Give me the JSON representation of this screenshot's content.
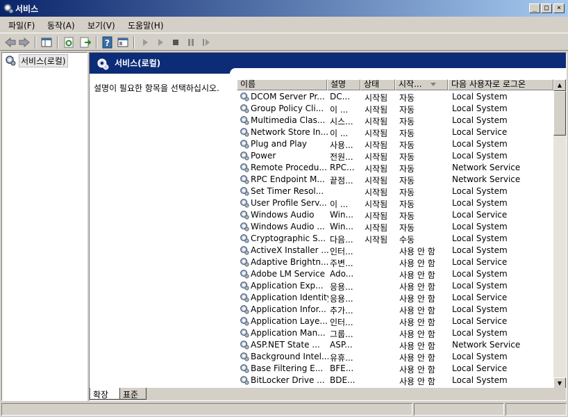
{
  "window": {
    "title": "서비스",
    "controls": [
      "_",
      "□",
      "×"
    ]
  },
  "menu": [
    "파일(F)",
    "동작(A)",
    "보기(V)",
    "도움말(H)"
  ],
  "toolbar": [
    "back-icon",
    "forward-icon",
    "console-tree-icon",
    "refresh-icon",
    "export-icon",
    "help-icon",
    "properties-icon",
    "play-icon",
    "play-icon",
    "stop-icon",
    "pause-icon",
    "restart-icon"
  ],
  "tree": {
    "root": "서비스(로컬)"
  },
  "pane": {
    "title": "서비스(로컬)",
    "description": "설명이 필요한 항목을 선택하십시오.",
    "columns": [
      "이름",
      "설명",
      "상태",
      "시작...",
      "다음 사용자로 로그온"
    ],
    "rows": [
      [
        "DCOM Server Pr...",
        "DC...",
        "시작됨",
        "자동",
        "Local System"
      ],
      [
        "Group Policy Cli...",
        "이 ...",
        "시작됨",
        "자동",
        "Local System"
      ],
      [
        "Multimedia Clas...",
        "시스...",
        "시작됨",
        "자동",
        "Local System"
      ],
      [
        "Network Store In...",
        "이 ...",
        "시작됨",
        "자동",
        "Local Service"
      ],
      [
        "Plug and Play",
        "사용...",
        "시작됨",
        "자동",
        "Local System"
      ],
      [
        "Power",
        "전원...",
        "시작됨",
        "자동",
        "Local System"
      ],
      [
        "Remote Procedu...",
        "RPC...",
        "시작됨",
        "자동",
        "Network Service"
      ],
      [
        "RPC Endpoint M...",
        "끝점...",
        "시작됨",
        "자동",
        "Network Service"
      ],
      [
        "Set Timer Resol...",
        "",
        "시작됨",
        "자동",
        "Local System"
      ],
      [
        "User Profile Serv...",
        "이 ...",
        "시작됨",
        "자동",
        "Local System"
      ],
      [
        "Windows Audio",
        "Win...",
        "시작됨",
        "자동",
        "Local Service"
      ],
      [
        "Windows Audio ...",
        "Win...",
        "시작됨",
        "자동",
        "Local System"
      ],
      [
        "Cryptographic S...",
        "다음...",
        "시작됨",
        "수동",
        "Local System"
      ],
      [
        "ActiveX Installer ...",
        "인터...",
        "",
        "사용 안 함",
        "Local System"
      ],
      [
        "Adaptive Brightn...",
        "주변...",
        "",
        "사용 안 함",
        "Local Service"
      ],
      [
        "Adobe LM Service",
        "Ado...",
        "",
        "사용 안 함",
        "Local System"
      ],
      [
        "Application Exp...",
        "응용...",
        "",
        "사용 안 함",
        "Local System"
      ],
      [
        "Application Identity",
        "응용...",
        "",
        "사용 안 함",
        "Local Service"
      ],
      [
        "Application Infor...",
        "추가...",
        "",
        "사용 안 함",
        "Local System"
      ],
      [
        "Application Laye...",
        "인터...",
        "",
        "사용 안 함",
        "Local Service"
      ],
      [
        "Application Man...",
        "그룹...",
        "",
        "사용 안 함",
        "Local System"
      ],
      [
        "ASP.NET State ...",
        "ASP...",
        "",
        "사용 안 함",
        "Network Service"
      ],
      [
        "Background Intel...",
        "유휴...",
        "",
        "사용 안 함",
        "Local System"
      ],
      [
        "Base Filtering E...",
        "BFE...",
        "",
        "사용 안 함",
        "Local Service"
      ],
      [
        "BitLocker Drive ...",
        "BDE...",
        "",
        "사용 안 함",
        "Local System"
      ]
    ],
    "tabs": [
      "확장",
      "표준"
    ]
  },
  "colors": {
    "titlebar": "#0a246a",
    "header": "#0c2c78",
    "face": "#d4d0c8"
  }
}
